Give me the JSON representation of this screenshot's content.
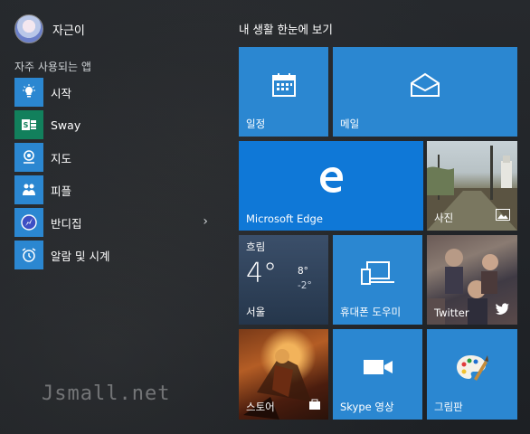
{
  "user": {
    "name": "자근이"
  },
  "frequent_label": "자주 사용되는 앱",
  "apps": [
    {
      "label": "시작",
      "icon": "lightbulb-icon",
      "color": "#2b87d1"
    },
    {
      "label": "Sway",
      "icon": "sway-icon",
      "color": "#12805c"
    },
    {
      "label": "지도",
      "icon": "maps-icon",
      "color": "#2b87d1"
    },
    {
      "label": "피플",
      "icon": "people-icon",
      "color": "#2b87d1"
    },
    {
      "label": "반디집",
      "icon": "bandizip-icon",
      "color": "#2b87d1",
      "has_submenu": true
    },
    {
      "label": "알람 및 시계",
      "icon": "alarm-clock-icon",
      "color": "#2b87d1"
    }
  ],
  "watermark": "Jsmall.net",
  "group_title": "내 생활 한눈에 보기",
  "tiles": {
    "calendar": "일정",
    "mail": "메일",
    "edge": "Microsoft Edge",
    "photos": "사진",
    "weather": {
      "condition": "흐림",
      "temp": "4°",
      "high": "8°",
      "low": "-2°",
      "city": "서울"
    },
    "phone": "휴대폰 도우미",
    "twitter": "Twitter",
    "store": "스토어",
    "skype": "Skype 영상",
    "paint": "그림판"
  },
  "colors": {
    "tile_blue": "#2b87d1",
    "edge_blue": "#0f78d7",
    "background": "#1f2226"
  }
}
